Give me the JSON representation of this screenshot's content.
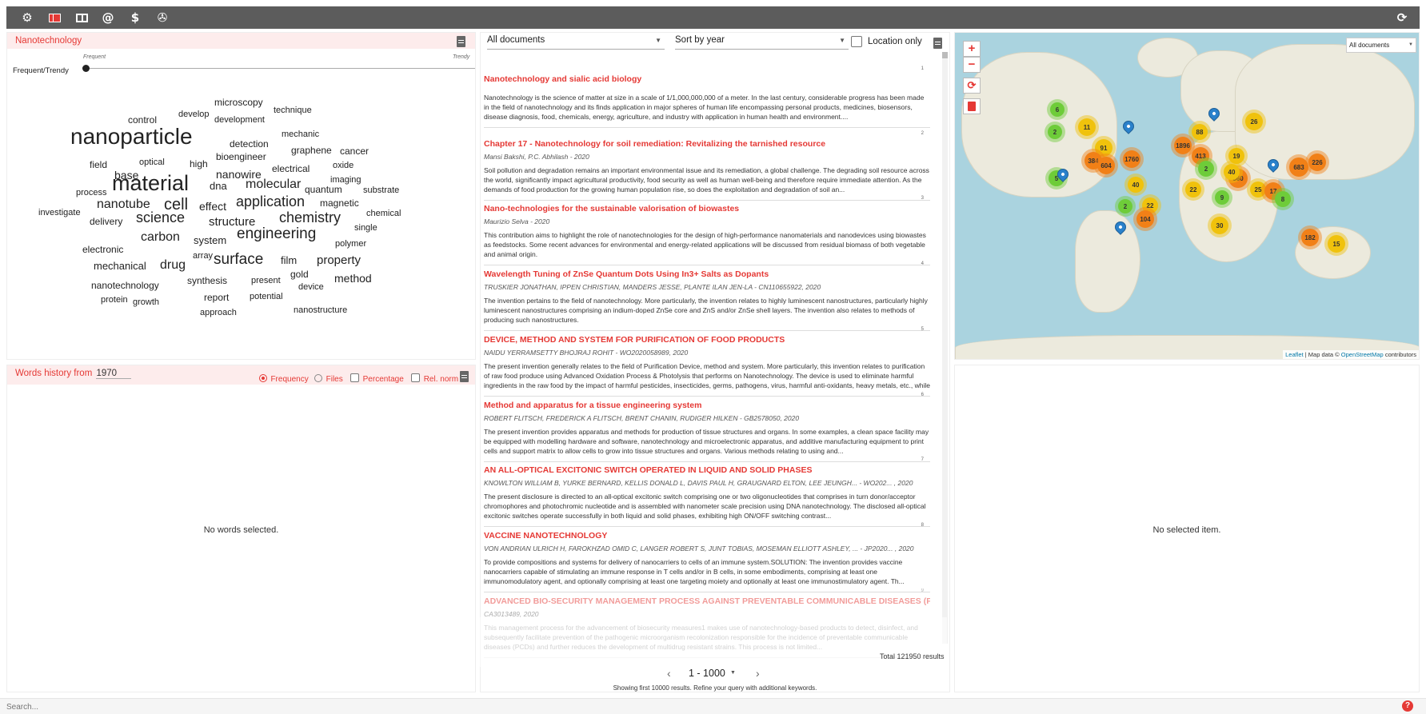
{
  "toolbar": {
    "icons": [
      "gear-icon",
      "panel-layout-icon",
      "book-icon",
      "at-icon",
      "dollar-icon",
      "aperture-icon",
      "refresh-icon"
    ],
    "gear": "⚙",
    "at": "@",
    "dollar": "$",
    "aperture": "✇",
    "refresh": "⟳"
  },
  "wordcloud": {
    "title": "Nanotechnology",
    "slider_label": "Frequent/Trendy",
    "frequent_label": "Frequent",
    "trendy_label": "Trendy",
    "words": [
      "microscopy",
      "technique",
      "develop",
      "development",
      "control",
      "mechanic",
      "nanoparticle",
      "detection",
      "graphene",
      "cancer",
      "bioengineer",
      "field",
      "optical",
      "high",
      "base",
      "oxide",
      "nanowire",
      "electrical",
      "imaging",
      "material",
      "dna",
      "molecular",
      "quantum",
      "substrate",
      "process",
      "magnetic",
      "nanotube",
      "cell",
      "effect",
      "application",
      "chemical",
      "investigate",
      "delivery",
      "science",
      "structure",
      "chemistry",
      "single",
      "carbon",
      "system",
      "engineering",
      "polymer",
      "electronic",
      "array",
      "mechanical",
      "drug",
      "surface",
      "film",
      "property",
      "gold",
      "method",
      "nanotechnology",
      "synthesis",
      "present",
      "device",
      "protein",
      "growth",
      "report",
      "potential",
      "nanostructure",
      "approach"
    ]
  },
  "history": {
    "title": "Words history from",
    "from_year": "1970",
    "opt_frequency": "Frequency",
    "opt_files": "Files",
    "opt_percentage": "Percentage",
    "opt_relnorm": "Rel. norm",
    "empty": "No words selected."
  },
  "results": {
    "filter": "All documents",
    "sort": "Sort by year",
    "location_only": "Location only",
    "items": [
      {
        "num": "1",
        "title": "Nanotechnology and sialic acid biology",
        "meta": "",
        "desc": "Nanotechnology is the science of matter at size in a scale of 1/1,000,000,000 of a meter. In the last century, considerable progress has been made in the field of nanotechnology and its finds application in major spheres of human life encompassing personal products, medicines, biosensors, disease diagnosis, food, chemicals, energy, agriculture, and industry with application in human health and environment...."
      },
      {
        "num": "2",
        "title": "Chapter 17 - Nanotechnology for soil remediation: Revitalizing the tarnished resource",
        "meta": "Mansi Bakshi, P.C. Abhilash - 2020",
        "desc": "Soil pollution and degradation remains an important environmental issue and its remediation, a global challenge. The degrading soil resource across the world, significantly impact agricultural productivity, food security as well as human well-being and therefore require immediate attention. As the demands of food production for the growing human population rise, so does the exploitation and degradation of soil an..."
      },
      {
        "num": "3",
        "title": "Nano-technologies for the sustainable valorisation of biowastes",
        "meta": "Maurizio Selva - 2020",
        "desc": "This contribution aims to highlight the role of nanotechnologies for the design of high-performance nanomaterials and nanodevices using biowastes as feedstocks. Some recent advances for environmental and energy-related applications will be discussed from residual biomass of both vegetable and animal origin."
      },
      {
        "num": "4",
        "title": "Wavelength Tuning of ZnSe Quantum Dots Using In3+ Salts as Dopants",
        "meta": "TRUSKIER JONATHAN, IPPEN CHRISTIAN, MANDERS JESSE, PLANTE ILAN JEN-LA - CN110655922, 2020",
        "desc": "The invention pertains to the field of nanotechnology. More particularly, the invention relates to highly luminescent nanostructures, particularly highly luminescent nanostructures comprising an indium-doped ZnSe core and ZnS and/or ZnSe shell layers. The invention also relates to methods of producing such nanostructures."
      },
      {
        "num": "5",
        "title": "DEVICE, METHOD AND SYSTEM FOR PURIFICATION OF FOOD PRODUCTS",
        "meta": "NAIDU YERRAMSETTY BHOJRAJ ROHIT - WO2020058989, 2020",
        "desc": "The present invention generally relates to the field of Purification Device, method and system. More particularly, this invention relates to purification of raw food produce using Advanced Oxidation Process & Photolysis that performs on Nanotechnology. The device is used to eliminate harmful ingredients in the raw food by the impact of harmful pesticides, insecticides, germs, pathogens, virus, harmful anti-oxidants, heavy metals, etc., while keeping the inherent..."
      },
      {
        "num": "6",
        "title": "Method and apparatus for a tissue engineering system",
        "meta": "ROBERT FLITSCH, FREDERICK A FLITSCH, BRENT CHANIN, RUDIGER HILKEN - GB2578050, 2020",
        "desc": "The present invention provides apparatus and methods for production of tissue structures and organs. In some examples, a clean space facility may be equipped with modelling hardware and software, nanotechnology and microelectronic apparatus, and additive manufacturing equipment to print cells and support matrix to allow cells to grow into tissue structures and organs. Various methods relating to using and..."
      },
      {
        "num": "7",
        "title": "AN ALL-OPTICAL EXCITONIC SWITCH OPERATED IN LIQUID AND SOLID PHASES",
        "meta": "KNOWLTON WILLIAM B, YURKE BERNARD, KELLIS DONALD L, DAVIS PAUL H, GRAUGNARD ELTON, LEE JEUNGH... - WO202... , 2020",
        "desc": "The present disclosure is directed to an all-optical excitonic switch comprising one or two oligonucleotides that comprises in turn donor/acceptor chromophores and photochromic nucleotide and is assembled with nanometer scale precision using DNA nanotechnology. The disclosed all-optical excitonic switches operate successfully in both liquid and solid phases, exhibiting high ON/OFF switching contrast..."
      },
      {
        "num": "8",
        "title": "VACCINE NANOTECHNOLOGY",
        "meta": "VON ANDRIAN ULRICH H, FAROKHZAD OMID C, LANGER ROBERT S, JUNT TOBIAS, MOSEMAN ELLIOTT ASHLEY, ... - JP2020... , 2020",
        "desc": "To provide compositions and systems for delivery of nanocarriers to cells of an immune system.SOLUTION: The invention provides vaccine nanocarriers capable of stimulating an immune response in T cells and/or in B cells, in some embodiments, comprising at least one immunomodulatory agent, and optionally comprising at least one targeting moiety and optionally at least one immunostimulatory agent. Th..."
      },
      {
        "num": "9",
        "title": "ADVANCED BIO-SECURITY MANAGEMENT PROCESS AGAINST PREVENTABLE COMMUNICABLE DISEASES (PCDS)",
        "meta": "CA3013489, 2020",
        "desc": "This management process for the advancement of biosecurity measures1 makes use of nanotechnology-based products to detect, disinfect, and subsequently facilitate prevention of the pathogenic microorganism recolonization responsible for the incidence of preventable communicable diseases (PCDs) and further reduces the development of multidrug resistant strains. This process is not limited..."
      }
    ],
    "total": "Total 121950 results",
    "page_range": "1 - 1000",
    "prev": "‹",
    "next": "›",
    "notice": "Showing first 10000 results. Refine your query with additional keywords."
  },
  "map": {
    "filter": "All documents",
    "zoom_in": "+",
    "zoom_out": "−",
    "reset": "⟳",
    "attribution_leaflet": "Leaflet",
    "attribution_text": "| Map data © ",
    "attribution_osm": "OpenStreetMap",
    "attribution_tail": " contributors",
    "clusters": [
      "6",
      "2",
      "11",
      "88",
      "26",
      "19",
      "91",
      "1896",
      "413",
      "384",
      "604",
      "1760",
      "2",
      "40",
      "360",
      "683",
      "226",
      "5",
      "40",
      "22",
      "25",
      "17",
      "8",
      "2",
      "22",
      "9",
      "104",
      "30",
      "182",
      "15"
    ]
  },
  "detail": {
    "empty": "No selected item."
  },
  "search": {
    "placeholder": "Search..."
  },
  "help": "?"
}
